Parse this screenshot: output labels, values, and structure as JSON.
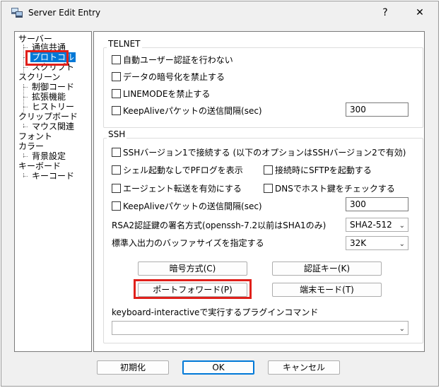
{
  "window": {
    "title": "Server Edit Entry",
    "help_glyph": "?",
    "close_glyph": "✕"
  },
  "tree": {
    "items": [
      {
        "label": "サーバー"
      },
      {
        "label": "通信共通"
      },
      {
        "label": "プロトコル"
      },
      {
        "label": "スクリプト"
      },
      {
        "label": "スクリーン"
      },
      {
        "label": "制御コード"
      },
      {
        "label": "拡張機能"
      },
      {
        "label": "ヒストリー"
      },
      {
        "label": "クリップボード"
      },
      {
        "label": "マウス関連"
      },
      {
        "label": "フォント"
      },
      {
        "label": "カラー"
      },
      {
        "label": "背景設定"
      },
      {
        "label": "キーボード"
      },
      {
        "label": "キーコード"
      }
    ],
    "selected": "プロトコル"
  },
  "telnet": {
    "legend": "TELNET",
    "auto_login": "自動ユーザー認証を行わない",
    "no_encrypt": "データの暗号化を禁止する",
    "no_linemode": "LINEMODEを禁止する",
    "keepalive": "KeepAliveパケットの送信間隔(sec)",
    "keepalive_value": "300"
  },
  "ssh": {
    "legend": "SSH",
    "ssh1": "SSHバージョン1で接続する (以下のオプションはSSHバージョン2で有効)",
    "no_shell": "シェル起動なしでPFログを表示",
    "sftp": "接続時にSFTPを起動する",
    "agent": "エージェント転送を有効にする",
    "dns": "DNSでホスト鍵をチェックする",
    "keepalive": "KeepAliveパケットの送信間隔(sec)",
    "keepalive_value": "300",
    "rsa_label": "RSA2認証鍵の署名方式(openssh-7.2以前はSHA1のみ)",
    "rsa_value": "SHA2-512",
    "buffer_label": "標準入出力のバッファサイズを指定する",
    "buffer_value": "32K",
    "btn_cipher": "暗号方式(C)",
    "btn_authkey": "認証キー(K)",
    "btn_portfwd": "ポートフォワード(P)",
    "btn_termmode": "端末モード(T)",
    "plugin_label": "keyboard-interactiveで実行するプラグインコマンド",
    "plugin_value": ""
  },
  "footer": {
    "init": "初期化",
    "ok": "OK",
    "cancel": "キャンセル"
  },
  "colors": {
    "highlight": "#e0201b",
    "selection": "#0078d7"
  }
}
